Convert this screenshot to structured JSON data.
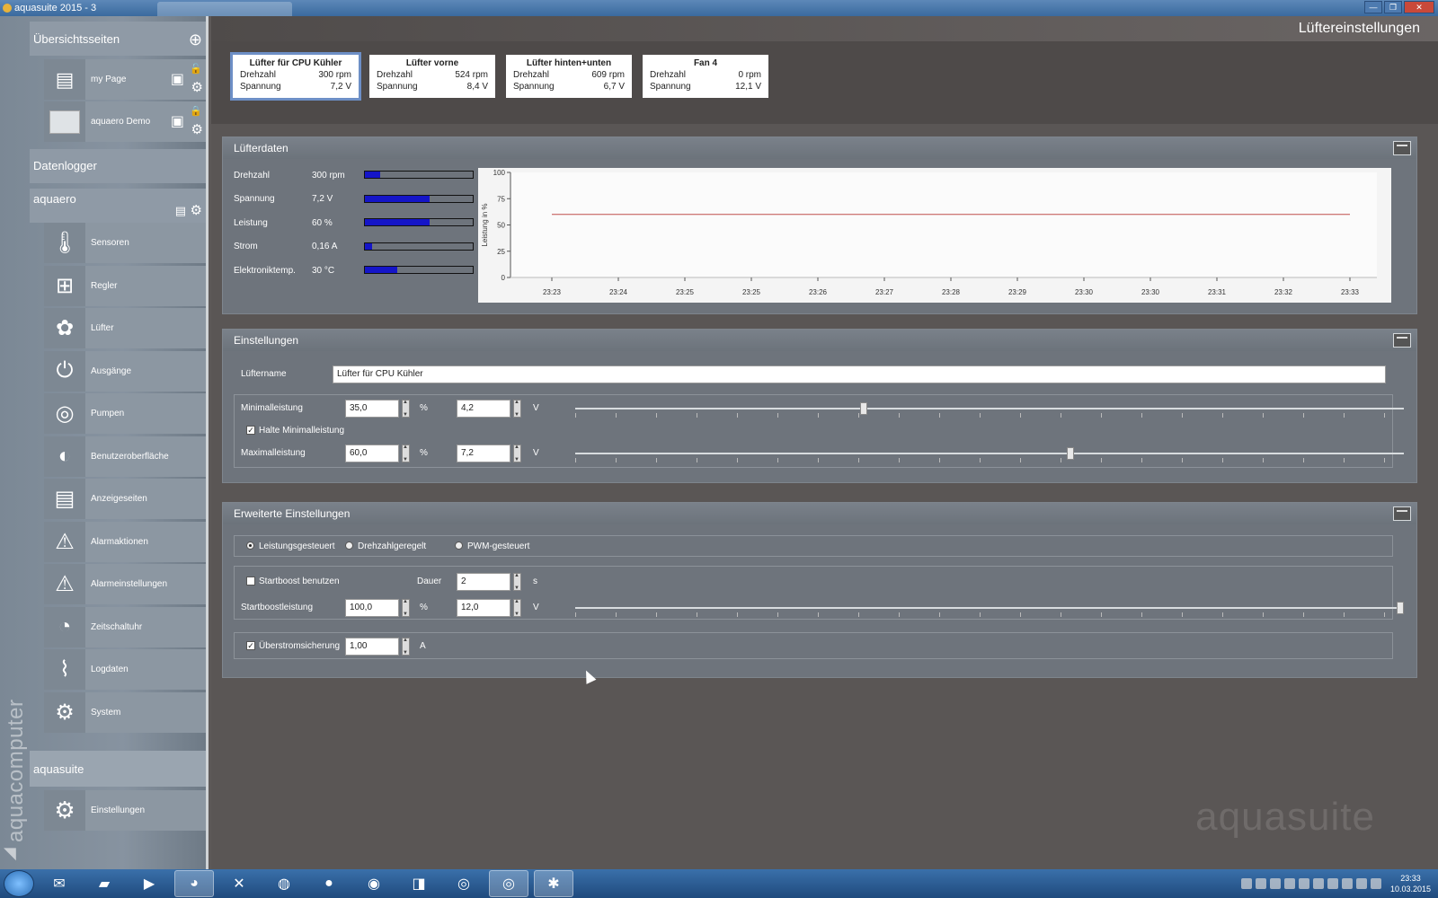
{
  "window": {
    "title": "aquasuite 2015 - 3",
    "min": "—",
    "max": "❐",
    "close": "✕"
  },
  "sidebar": {
    "overview_heading": "Übersichtsseiten",
    "pages": [
      {
        "label": "my Page",
        "icon": "display-pages-icon"
      },
      {
        "label": "aquaero Demo",
        "icon": "dashboard-thumbnail-icon"
      }
    ],
    "datalogger_heading": "Datenlogger",
    "aquaero_heading": "aquaero",
    "items": [
      {
        "label": "Sensoren",
        "icon": "thermometer-icon",
        "glyph": "🌡"
      },
      {
        "label": "Regler",
        "icon": "controller-icon",
        "glyph": "⊞"
      },
      {
        "label": "Lüfter",
        "icon": "fan-icon",
        "glyph": "✿"
      },
      {
        "label": "Ausgänge",
        "icon": "plug-icon",
        "glyph": "⏻"
      },
      {
        "label": "Pumpen",
        "icon": "pump-icon",
        "glyph": "◎"
      },
      {
        "label": "Benutzeroberfläche",
        "icon": "brightness-icon",
        "glyph": "◐"
      },
      {
        "label": "Anzeigeseiten",
        "icon": "display-pages-icon",
        "glyph": "▤"
      },
      {
        "label": "Alarmaktionen",
        "icon": "warning-icon",
        "glyph": "⚠"
      },
      {
        "label": "Alarmeinstellungen",
        "icon": "warning-settings-icon",
        "glyph": "⚠"
      },
      {
        "label": "Zeitschaltuhr",
        "icon": "clock-icon",
        "glyph": "◔"
      },
      {
        "label": "Logdaten",
        "icon": "log-chart-icon",
        "glyph": "⌇"
      },
      {
        "label": "System",
        "icon": "gears-icon",
        "glyph": "⚙"
      }
    ],
    "aquasuite_heading": "aquasuite",
    "suite_items": [
      {
        "label": "Einstellungen",
        "icon": "gears-icon",
        "glyph": "⚙"
      }
    ],
    "brand": "aquacomputer"
  },
  "header": {
    "title": "Lüftereinstellungen"
  },
  "fans": [
    {
      "name": "Lüfter für CPU Kühler",
      "speed_label": "Drehzahl",
      "speed": "300 rpm",
      "volt_label": "Spannung",
      "voltage": "7,2 V",
      "active": true
    },
    {
      "name": "Lüfter vorne",
      "speed_label": "Drehzahl",
      "speed": "524 rpm",
      "volt_label": "Spannung",
      "voltage": "8,4 V",
      "active": false
    },
    {
      "name": "Lüfter hinten+unten",
      "speed_label": "Drehzahl",
      "speed": "609 rpm",
      "volt_label": "Spannung",
      "voltage": "6,7 V",
      "active": false
    },
    {
      "name": "Fan 4",
      "speed_label": "Drehzahl",
      "speed": "0 rpm",
      "volt_label": "Spannung",
      "voltage": "12,1 V",
      "active": false
    }
  ],
  "fan_data": {
    "heading": "Lüfterdaten",
    "rows": [
      {
        "label": "Drehzahl",
        "value": "300 rpm",
        "level": 0.14
      },
      {
        "label": "Spannung",
        "value": "7,2 V",
        "level": 0.6
      },
      {
        "label": "Leistung",
        "value": "60 %",
        "level": 0.6
      },
      {
        "label": "Strom",
        "value": "0,16 A",
        "level": 0.07
      },
      {
        "label": "Elektroniktemp.",
        "value": "30 °C",
        "level": 0.3
      }
    ]
  },
  "chart_data": {
    "type": "line",
    "ylabel": "Leistung in %",
    "ylim": [
      0,
      100
    ],
    "y_ticks": [
      "100",
      "75",
      "50",
      "25",
      "0"
    ],
    "categories": [
      "23:23",
      "23:24",
      "23:25",
      "23:25",
      "23:26",
      "23:27",
      "23:28",
      "23:29",
      "23:30",
      "23:30",
      "23:31",
      "23:32",
      "23:33"
    ],
    "series": [
      {
        "values": [
          60,
          60,
          60,
          60,
          60,
          60,
          60,
          60,
          60,
          60,
          60,
          60,
          60
        ],
        "color": "#c0504d"
      }
    ],
    "grid": false
  },
  "settings": {
    "heading": "Einstellungen",
    "name_label": "Lüftername",
    "name_value": "Lüfter für CPU Kühler",
    "min_label": "Minimalleistung",
    "min_percent": "35,0",
    "min_volt": "4,2",
    "min_level": 0.35,
    "hold_min_label": "Halte Minimalleistung",
    "hold_min_checked": true,
    "max_label": "Maximalleistung",
    "max_percent": "60,0",
    "max_volt": "7,2",
    "max_level": 0.6,
    "unit_percent": "%",
    "unit_volt": "V"
  },
  "advanced": {
    "heading": "Erweiterte Einstellungen",
    "modes": [
      {
        "label": "Leistungsgesteuert",
        "selected": true
      },
      {
        "label": "Drehzahlgeregelt",
        "selected": false
      },
      {
        "label": "PWM-gesteuert",
        "selected": false
      }
    ],
    "startboost_label": "Startboost benutzen",
    "startboost_checked": false,
    "duration_label": "Dauer",
    "duration_value": "2",
    "duration_unit": "s",
    "boost_power_label": "Startboostleistung",
    "boost_percent": "100,0",
    "boost_volt": "12,0",
    "boost_level": 1.0,
    "overcurrent_label": "Überstromsicherung",
    "overcurrent_checked": true,
    "overcurrent_value": "1,00",
    "overcurrent_unit": "A",
    "unit_percent": "%",
    "unit_volt": "V"
  },
  "watermark": "aquasuite",
  "taskbar": {
    "apps": [
      "outlook-icon",
      "folder-icon",
      "media-player-icon",
      "aquasuite-icon",
      "tool-icon",
      "network-icon",
      "browser-icon",
      "steam-icon",
      "uplay-icon",
      "chrome-icon",
      "chrome-icon",
      "app-icon"
    ],
    "time": "23:33",
    "date": "10.03.2015"
  },
  "colors": {
    "accent": "#6d8fc6",
    "bar": "#1515c8",
    "chart_line": "#c0504d"
  }
}
